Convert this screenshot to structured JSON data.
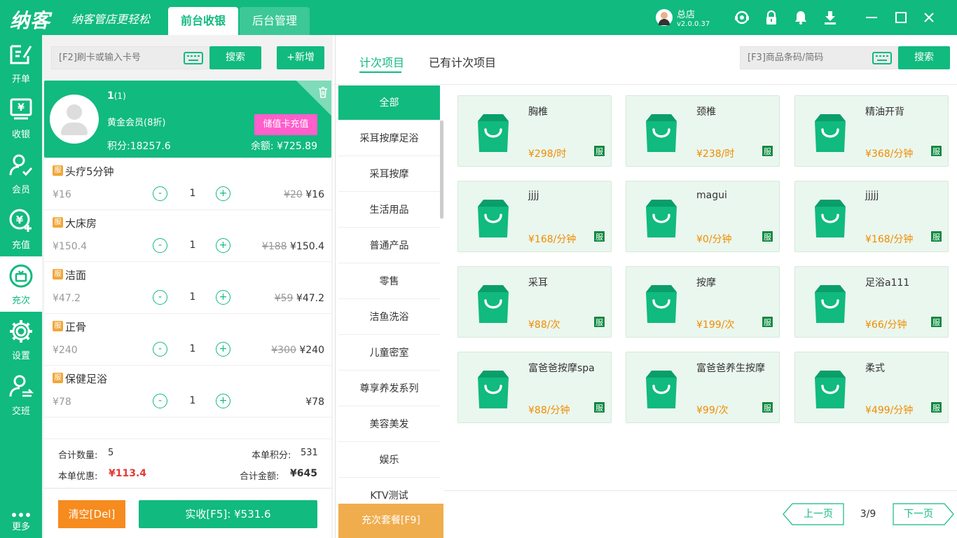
{
  "header": {
    "logo": "纳客",
    "slogan": "纳客管店更轻松",
    "tabs": [
      {
        "label": "前台收银"
      },
      {
        "label": "后台管理"
      }
    ],
    "user_name": "总店",
    "version": "v2.0.0.37"
  },
  "sidebar": {
    "items": [
      {
        "label": "开单"
      },
      {
        "label": "收银"
      },
      {
        "label": "会员"
      },
      {
        "label": "充值"
      },
      {
        "label": "充次"
      },
      {
        "label": "设置"
      },
      {
        "label": "交班"
      },
      {
        "label": "更多"
      }
    ]
  },
  "left": {
    "card_placeholder": "[F2]刷卡或输入卡号",
    "search_label": "搜索",
    "add_label": "+新增",
    "member": {
      "name": "1",
      "count": "(1)",
      "level": "黄金会员(8折)",
      "points": "积分:18257.6",
      "balance": "余额: ¥725.89",
      "recharge_label": "储值卡充值"
    },
    "items": [
      {
        "badge": "服",
        "name": "头疗5分钟",
        "price": "¥16",
        "qty": "1",
        "orig": "¥20",
        "total": "¥16"
      },
      {
        "badge": "服",
        "name": "大床房",
        "price": "¥150.4",
        "qty": "1",
        "orig": "¥188",
        "total": "¥150.4"
      },
      {
        "badge": "服",
        "name": "洁面",
        "price": "¥47.2",
        "qty": "1",
        "orig": "¥59",
        "total": "¥47.2"
      },
      {
        "badge": "服",
        "name": "正骨",
        "price": "¥240",
        "qty": "1",
        "orig": "¥300",
        "total": "¥240"
      },
      {
        "badge": "服",
        "name": "保健足浴",
        "price": "¥78",
        "qty": "1",
        "orig": "",
        "total": "¥78"
      }
    ],
    "summary": {
      "qty_label": "合计数量:",
      "qty": "5",
      "points_label": "本单积分:",
      "points": "531",
      "discount_label": "本单优惠:",
      "discount": "¥113.4",
      "total_label": "合计金额:",
      "total": "¥645"
    },
    "clear_label": "清空[Del]",
    "pay_label": "实收[F5]: ¥531.6"
  },
  "right": {
    "tabs": [
      {
        "label": "计次项目"
      },
      {
        "label": "已有计次项目"
      }
    ],
    "search_placeholder": "[F3]商品条码/简码",
    "search_label": "搜索",
    "categories": [
      "全部",
      "采耳按摩足浴",
      "采耳按摩",
      "生活用品",
      "普通产品",
      "零售",
      "洁鱼洗浴",
      "儿童密室",
      "尊享养发系列",
      "美容美发",
      "娱乐",
      "KTV测试"
    ],
    "package_label": "充次套餐[F9]",
    "products": [
      {
        "name": "胸椎",
        "price": "¥298/时",
        "badge": "服"
      },
      {
        "name": "颈椎",
        "price": "¥238/时",
        "badge": "服"
      },
      {
        "name": "精油开背",
        "price": "¥368/分钟",
        "badge": "服"
      },
      {
        "name": "jjjj",
        "price": "¥168/分钟",
        "badge": "服"
      },
      {
        "name": "magui",
        "price": "¥0/分钟",
        "badge": "服"
      },
      {
        "name": "jjjjj",
        "price": "¥168/分钟",
        "badge": "服"
      },
      {
        "name": "采耳",
        "price": "¥88/次",
        "badge": "服"
      },
      {
        "name": "按摩",
        "price": "¥199/次",
        "badge": "服"
      },
      {
        "name": "足浴a111",
        "price": "¥66/分钟",
        "badge": "服"
      },
      {
        "name": "富爸爸按摩spa",
        "price": "¥88/分钟",
        "badge": "服"
      },
      {
        "name": "富爸爸养生按摩",
        "price": "¥99/次",
        "badge": "服"
      },
      {
        "name": "柔式",
        "price": "¥499/分钟",
        "badge": "服"
      }
    ],
    "pager": {
      "prev": "上一页",
      "page": "3/9",
      "next": "下一页"
    }
  },
  "colors": {
    "primary": "#11ba7f",
    "accent": "#f0ad4e",
    "price": "#f08c00",
    "danger": "#e53935",
    "recharge": "#ff5ecb"
  }
}
